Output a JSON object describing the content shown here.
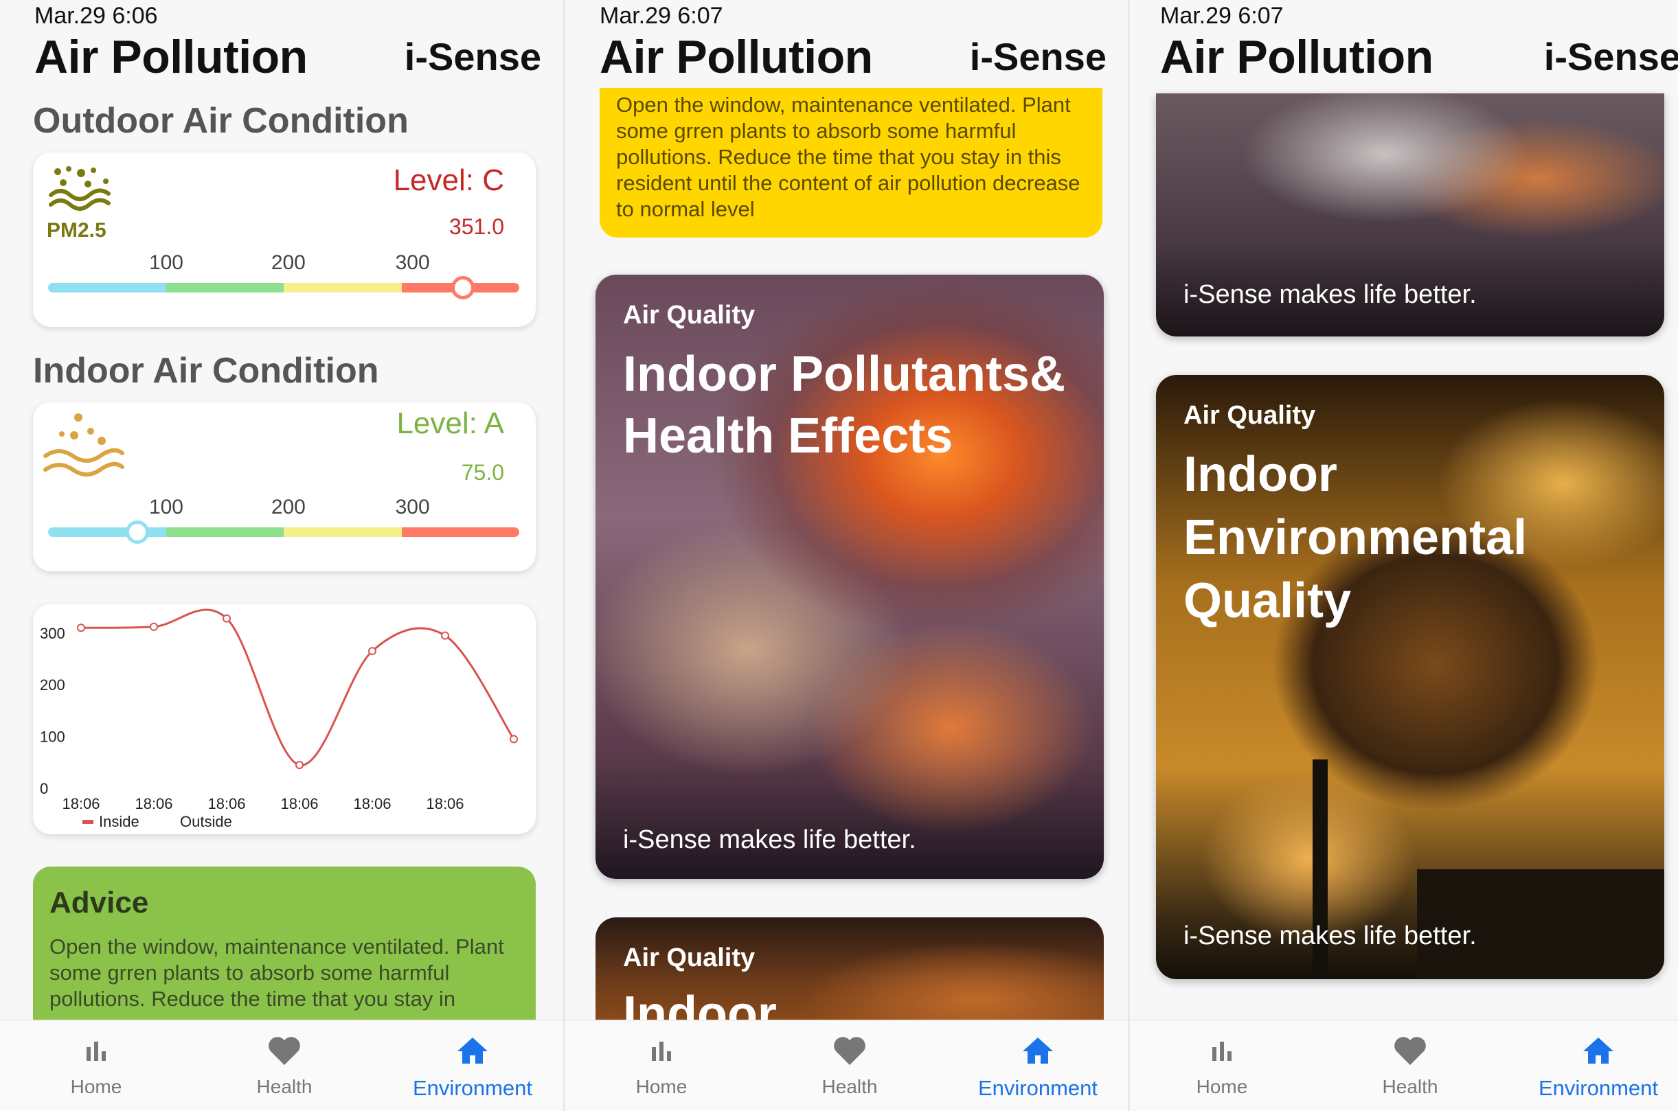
{
  "screens": [
    {
      "status_time": "Mar.29 6:06",
      "title": "Air Pollution",
      "brand": "i-Sense",
      "outdoor": {
        "section_title": "Outdoor Air Condition",
        "icon_label": "PM2.5",
        "level": "Level: C",
        "value": "351.0",
        "level_color": "#c62828",
        "ticks": [
          "100",
          "200",
          "300"
        ],
        "slider_fraction": 0.88
      },
      "indoor": {
        "section_title": "Indoor Air Condition",
        "level": "Level: A",
        "value": "75.0",
        "level_color": "#7cb342",
        "ticks": [
          "100",
          "200",
          "300"
        ],
        "slider_fraction": 0.19
      },
      "advice": {
        "title": "Advice",
        "text": "Open the window, maintenance ventilated. Plant some grren plants to absorb some harmful pollutions. Reduce the time that you stay in"
      }
    },
    {
      "status_time": "Mar.29 6:07",
      "title": "Air Pollution",
      "brand": "i-Sense",
      "advice_tail": "Open the window, maintenance ventilated. Plant some grren plants to absorb some harmful pollutions. Reduce the time that you stay in this resident until the content of air pollution decrease to normal level",
      "cards": [
        {
          "category": "Air Quality",
          "title_line1": "Indoor Pollutants&",
          "title_line2": "Health Effects",
          "tagline": "i-Sense makes life better."
        },
        {
          "category": "Air Quality",
          "title_line1": "Indoor"
        }
      ]
    },
    {
      "status_time": "Mar.29 6:07",
      "title": "Air Pollution",
      "brand": "i-Sense",
      "cards": [
        {
          "tagline": "i-Sense makes life better."
        },
        {
          "category": "Air Quality",
          "title_line1": "Indoor",
          "title_line2": "Environmental",
          "title_line3": "Quality",
          "tagline": "i-Sense makes life better."
        }
      ]
    }
  ],
  "chart_data": {
    "type": "line",
    "x": [
      "18:06",
      "18:06",
      "18:06",
      "18:06",
      "18:06",
      "18:06",
      "18:06"
    ],
    "series": [
      {
        "name": "Inside",
        "values": [
          310,
          312,
          328,
          45,
          265,
          295,
          95
        ],
        "color": "#d9534f"
      },
      {
        "name": "Outside",
        "values": []
      }
    ],
    "yticks": [
      "0",
      "100",
      "200",
      "300"
    ],
    "ylim": [
      0,
      400
    ],
    "legend": "bottom-left"
  },
  "nav": {
    "items": [
      {
        "label": "Home",
        "icon": "bar-chart-icon"
      },
      {
        "label": "Health",
        "icon": "heart-icon"
      },
      {
        "label": "Environment",
        "icon": "home-icon"
      }
    ],
    "active_color": "#1a73e8",
    "inactive_color": "#777777"
  }
}
